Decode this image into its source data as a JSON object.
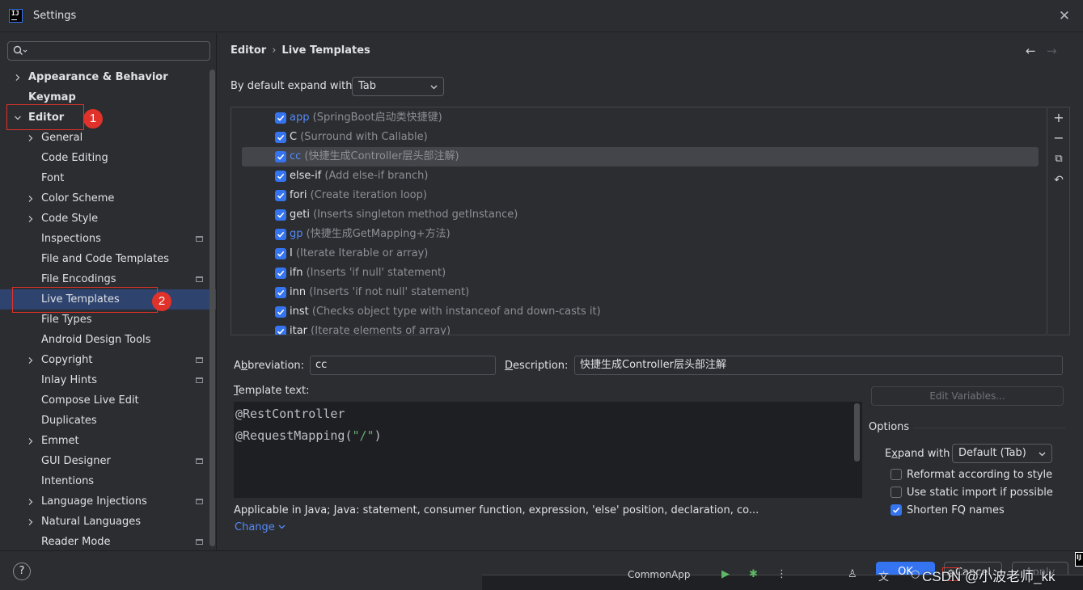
{
  "window": {
    "title": "Settings",
    "app_icon_text": "IJ"
  },
  "sidebar": {
    "search_placeholder": "",
    "items": [
      {
        "label": "Appearance & Behavior",
        "level": 0,
        "expandable": true,
        "bold": true
      },
      {
        "label": "Keymap",
        "level": 0,
        "expandable": false,
        "bold": true
      },
      {
        "label": "Editor",
        "level": 0,
        "expandable": true,
        "expanded": true,
        "bold": true
      },
      {
        "label": "General",
        "level": 1,
        "expandable": true
      },
      {
        "label": "Code Editing",
        "level": 1
      },
      {
        "label": "Font",
        "level": 1
      },
      {
        "label": "Color Scheme",
        "level": 1,
        "expandable": true
      },
      {
        "label": "Code Style",
        "level": 1,
        "expandable": true
      },
      {
        "label": "Inspections",
        "level": 1,
        "config_icon": true
      },
      {
        "label": "File and Code Templates",
        "level": 1
      },
      {
        "label": "File Encodings",
        "level": 1,
        "config_icon": true
      },
      {
        "label": "Live Templates",
        "level": 1,
        "selected": true
      },
      {
        "label": "File Types",
        "level": 1
      },
      {
        "label": "Android Design Tools",
        "level": 1
      },
      {
        "label": "Copyright",
        "level": 1,
        "expandable": true,
        "config_icon": true
      },
      {
        "label": "Inlay Hints",
        "level": 1,
        "config_icon": true
      },
      {
        "label": "Compose Live Edit",
        "level": 1
      },
      {
        "label": "Duplicates",
        "level": 1
      },
      {
        "label": "Emmet",
        "level": 1,
        "expandable": true
      },
      {
        "label": "GUI Designer",
        "level": 1,
        "config_icon": true
      },
      {
        "label": "Intentions",
        "level": 1
      },
      {
        "label": "Language Injections",
        "level": 1,
        "expandable": true,
        "config_icon": true
      },
      {
        "label": "Natural Languages",
        "level": 1,
        "expandable": true
      },
      {
        "label": "Reader Mode",
        "level": 1,
        "config_icon": true
      }
    ]
  },
  "annotations": {
    "first": "1",
    "second": "2"
  },
  "main": {
    "breadcrumb": {
      "parent": "Editor",
      "separator": "›",
      "current": "Live Templates"
    },
    "expand_label": "By default expand with",
    "expand_value": "Tab",
    "templates": [
      {
        "abbr": "app",
        "desc": "(SpringBoot启动类快捷键)",
        "custom": true
      },
      {
        "abbr": "C",
        "desc": "(Surround with Callable)"
      },
      {
        "abbr": "cc",
        "desc": "(快捷生成Controller层头部注解)",
        "custom": true,
        "selected": true
      },
      {
        "abbr": "else-if",
        "desc": "(Add else-if branch)"
      },
      {
        "abbr": "fori",
        "desc": "(Create iteration loop)"
      },
      {
        "abbr": "geti",
        "desc": "(Inserts singleton method getInstance)"
      },
      {
        "abbr": "gp",
        "desc": "(快捷生成GetMapping+方法)",
        "custom": true
      },
      {
        "abbr": "I",
        "desc": "(Iterate Iterable or array)"
      },
      {
        "abbr": "ifn",
        "desc": "(Inserts 'if null' statement)"
      },
      {
        "abbr": "inn",
        "desc": "(Inserts 'if not null' statement)"
      },
      {
        "abbr": "inst",
        "desc": "(Checks object type with instanceof and down-casts it)"
      },
      {
        "abbr": "itar",
        "desc": "(Iterate elements of array)"
      }
    ],
    "abbreviation_label_pre": "A",
    "abbreviation_label_ul": "b",
    "abbreviation_label_post": "breviation:",
    "abbreviation_value": "cc",
    "description_label_ul": "D",
    "description_label_post": "escription:",
    "description_value": "快捷生成Controller层头部注解",
    "template_text_label_ul": "T",
    "template_text_label_post": "emplate text:",
    "code": {
      "line1": "@RestController",
      "line2_pre": "@RequestMapping(",
      "line2_str": "\"/\"",
      "line2_post": ")"
    },
    "applicable": "Applicable in Java; Java: statement, consumer function, expression, 'else' position, declaration, co...",
    "change_link": "Change",
    "edit_variables": "Edit Variables...",
    "options": {
      "title": "Options",
      "expand_with_label_pre": "E",
      "expand_with_label_ul": "x",
      "expand_with_label_post": "pand with",
      "expand_with_value": "Default (Tab)",
      "reformat": "Reformat according to style",
      "static_import": "Use static import if possible",
      "shorten_fq": "Shorten FQ names"
    }
  },
  "bottom": {
    "help": "?",
    "ok": "OK",
    "cancel": "Cancel",
    "apply": "Apply",
    "overlay_text": "CommonApp",
    "watermark": "CSDN @小波老师_kk"
  }
}
